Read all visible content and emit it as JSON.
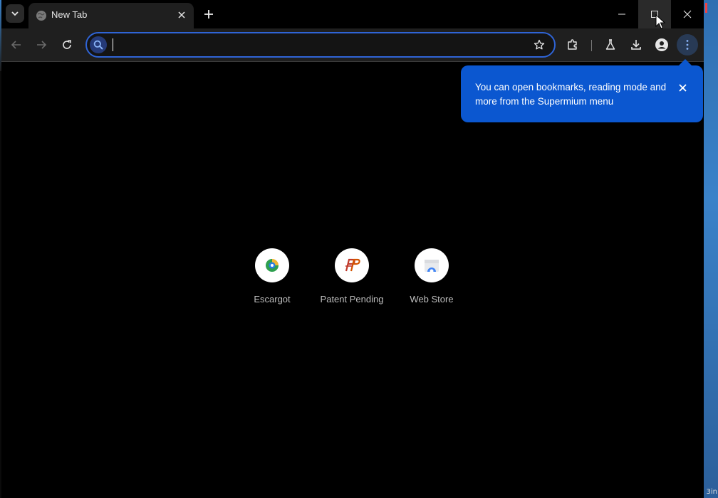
{
  "browser": {
    "tab": {
      "title": "New Tab",
      "favicon": "globe-icon"
    },
    "toolbar": {
      "omnibox_value": "",
      "omnibox_placeholder": ""
    }
  },
  "promo_bubble": {
    "text": "You can open bookmarks, reading mode and more from the Supermium menu"
  },
  "shortcuts": [
    {
      "label": "Escargot"
    },
    {
      "label": "Patent Pending"
    },
    {
      "label": "Web Store"
    }
  ],
  "taskbar": {
    "clock_fragment": "3in"
  },
  "colors": {
    "accent": "#0b57d0",
    "omnibox_border": "#2f64d6",
    "background": "#000000"
  }
}
